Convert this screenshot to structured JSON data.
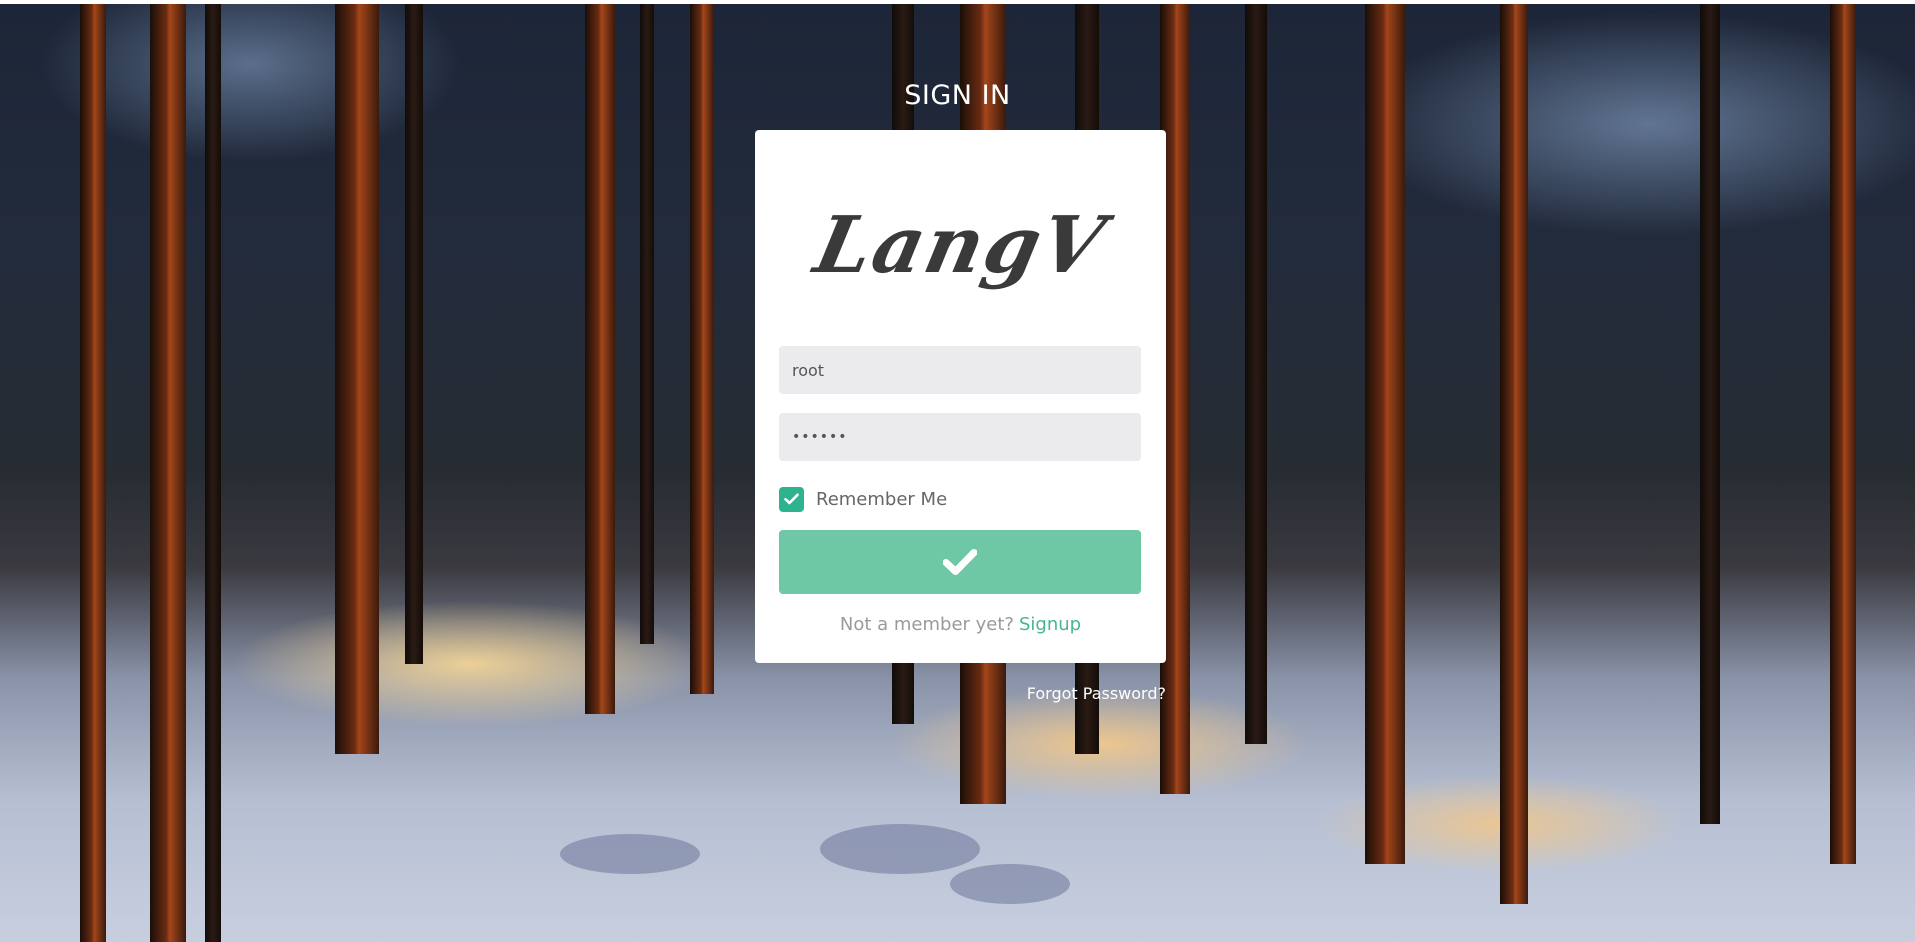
{
  "page": {
    "title": "SIGN IN",
    "background_image": "snowy-pine-forest-at-sunset"
  },
  "card": {
    "logo_text": "LangV",
    "username": {
      "value": "root",
      "placeholder": ""
    },
    "password": {
      "value": "••••••",
      "placeholder": ""
    },
    "remember_me": {
      "label": "Remember Me",
      "checked": true
    },
    "submit_icon": "check-icon",
    "signup": {
      "prompt": "Not a member yet?",
      "link": "Signup"
    }
  },
  "forgot_password": "Forgot Password?",
  "colors": {
    "accent": "#2fb38f",
    "button": "#6fc8a5",
    "link": "#49b48f",
    "field_bg": "#ebebed"
  }
}
